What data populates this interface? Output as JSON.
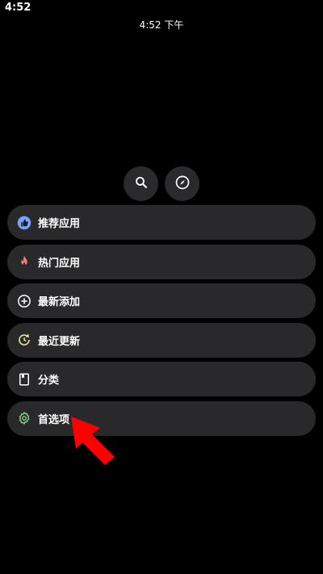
{
  "status_bar": {
    "time": "4:52"
  },
  "header": {
    "time": "4:52 下午"
  },
  "top_buttons": [
    {
      "icon": "search-icon"
    },
    {
      "icon": "compass-icon"
    }
  ],
  "menu": {
    "items": [
      {
        "label": "推荐应用",
        "icon": "thumbs-up-icon",
        "color": "#7aa2f7"
      },
      {
        "label": "热门应用",
        "icon": "flame-icon",
        "color": "#f47c6b"
      },
      {
        "label": "最新添加",
        "icon": "plus-circle-icon",
        "color": "#ffffff"
      },
      {
        "label": "最近更新",
        "icon": "update-icon",
        "color": "#e6e29a"
      },
      {
        "label": "分类",
        "icon": "bookmark-icon",
        "color": "#ffffff"
      },
      {
        "label": "首选项",
        "icon": "gear-icon",
        "color": "#86d28d"
      }
    ]
  },
  "annotation": {
    "arrow_color": "#ff0000"
  }
}
